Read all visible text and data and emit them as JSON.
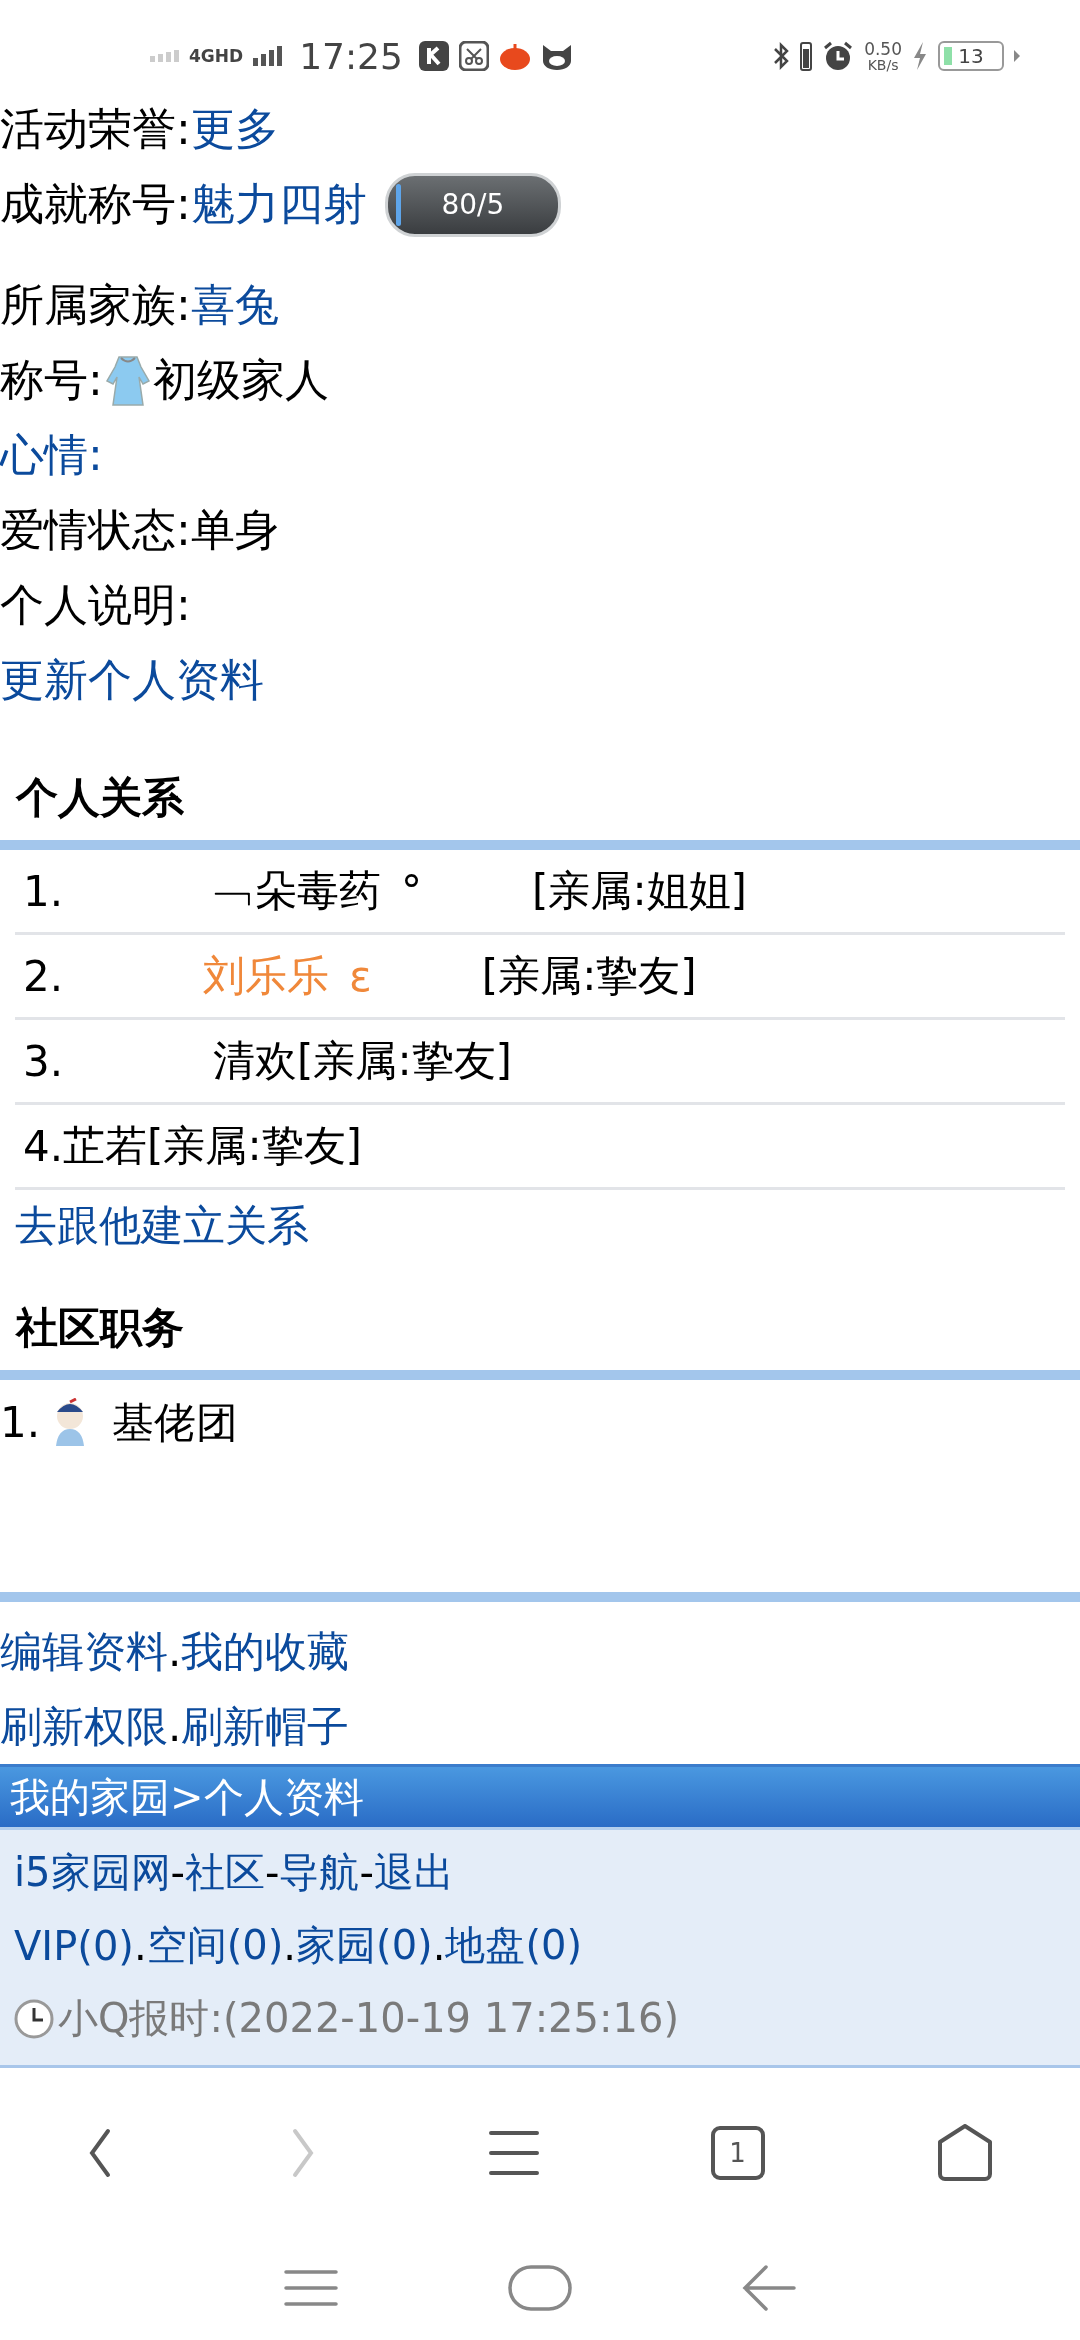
{
  "status_bar": {
    "network": "4GHD",
    "time": "17:25",
    "speed": "0.50",
    "speed_unit": "KB/s",
    "battery": "13"
  },
  "profile": [
    {
      "kind": "pair",
      "label": "活动荣誉:",
      "value": "更多",
      "value_link": true
    },
    {
      "kind": "pair",
      "label": "成就称号:",
      "value": "魅力四射",
      "value_link": true,
      "badge": "80/5",
      "level": 0.03
    },
    {
      "kind": "pair",
      "label": "所属家族:",
      "value": "喜兔",
      "value_link": true
    },
    {
      "kind": "icon-pair",
      "label": "称号:",
      "value": "初级家人",
      "value_link": false
    },
    {
      "kind": "link",
      "text": "心情:"
    },
    {
      "kind": "pair",
      "label": "爱情状态:",
      "value": "单身",
      "value_link": false
    },
    {
      "kind": "label",
      "text": "个人说明:"
    },
    {
      "kind": "link",
      "text": "更新个人资料"
    }
  ],
  "relations": {
    "title": "个人关系",
    "rows": [
      {
        "number": "1.",
        "name": "﹁朵毒药",
        "suffix": "°",
        "relation": "[亲属:姐姐]",
        "color": "#000000"
      },
      {
        "number": "2.",
        "name": "刘乐乐",
        "suffix": "ε",
        "relation": "[亲属:挚友]",
        "color": "#f0883a"
      },
      {
        "number": "3.",
        "name": "清欢",
        "relation": "[亲属:挚友]",
        "color": "#000000"
      },
      {
        "number": "4.",
        "name": "芷若",
        "relation": "[亲属:挚友]",
        "color": "#000000"
      }
    ],
    "link": "去跟他建立关系"
  },
  "community": {
    "title": "社区职务",
    "items": [
      {
        "number": "1.",
        "title": "基佬团"
      }
    ]
  },
  "footer_links": [
    {
      "separator": ".",
      "links": [
        "编辑资料",
        "我的收藏"
      ]
    },
    {
      "separator": ".",
      "links": [
        "刷新权限",
        "刷新帽子"
      ]
    }
  ],
  "breadcrumb": "我的家园>个人资料",
  "site_nav": [
    {
      "separator": "-",
      "links": [
        "i5家园网",
        "社区",
        "导航",
        "退出"
      ]
    },
    {
      "separator": ".",
      "links": [
        "VIP(0)",
        "空间(0)",
        "家园(0)",
        "地盘(0)"
      ]
    }
  ],
  "clock_text": "小Q报时:(2022-10-19 17:25:16)",
  "browser_bar": {
    "forward_disabled": true,
    "tab_count": "1"
  }
}
